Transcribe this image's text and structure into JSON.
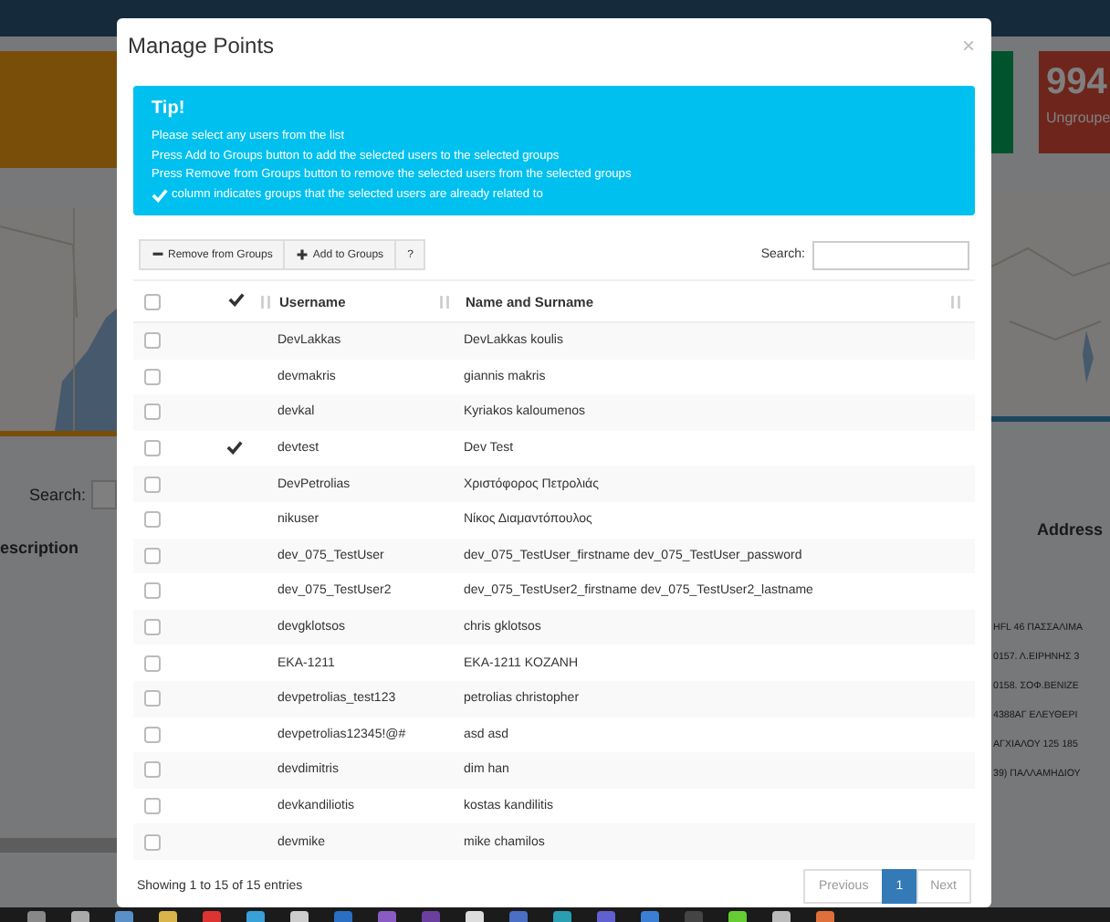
{
  "background": {
    "tile_number": "994",
    "tile_label": "Ungroupe",
    "search_label": "Search:",
    "left_column": "escription",
    "right_column": "Address",
    "addresses": [
      "HFL 46 ΠΑΣΣΑΛΙΜΑ",
      "0157. Λ.ΕΙΡΗΝΗΣ 3",
      "0158. ΣΟΦ.ΒΕΝΙΖΕ",
      "4388ΑΓ ΕΛΕΥΘΕΡΙ",
      "ΑΓΧΙΑΛΟΥ 125 185",
      "39) ΠΑΛΛΑΜΗΔΙΟΥ"
    ]
  },
  "modal": {
    "title": "Manage Points",
    "close": "×",
    "tip": {
      "title": "Tip!",
      "lines": [
        "Please select any users from the list",
        "Press Add to Groups button to add the selected users to the selected groups",
        "Press Remove from Groups button to remove the selected users from the selected groups",
        "column indicates groups that the selected users are already related to"
      ]
    },
    "toolbar": [
      {
        "label": "Remove from Groups",
        "kind": "remove"
      },
      {
        "label": "Add to Groups",
        "kind": "add"
      },
      {
        "label": "?",
        "kind": "help"
      }
    ],
    "search": {
      "label": "Search:"
    },
    "table": {
      "select_all": {
        "checked": false
      },
      "columns": [
        "Username",
        "Name and Surname"
      ],
      "rows": [
        {
          "checked": false,
          "related": false,
          "username": "DevLakkas",
          "name": "DevLakkas koulis"
        },
        {
          "checked": false,
          "related": false,
          "username": "devmakris",
          "name": "giannis makris"
        },
        {
          "checked": false,
          "related": false,
          "username": "devkal",
          "name": "Kyriakos kaloumenos"
        },
        {
          "checked": false,
          "related": true,
          "username": "devtest",
          "name": "Dev Test"
        },
        {
          "checked": false,
          "related": false,
          "username": "DevPetrolias",
          "name": "Χριστόφορος Πετρολιάς"
        },
        {
          "checked": false,
          "related": false,
          "username": "nikuser",
          "name": "Νίκος Διαμαντόπουλος"
        },
        {
          "checked": false,
          "related": false,
          "username": "dev_075_TestUser",
          "name": "dev_075_TestUser_firstname dev_075_TestUser_password"
        },
        {
          "checked": false,
          "related": false,
          "username": "dev_075_TestUser2",
          "name": "dev_075_TestUser2_firstname dev_075_TestUser2_lastname"
        },
        {
          "checked": false,
          "related": false,
          "username": "devgklotsos",
          "name": "chris gklotsos"
        },
        {
          "checked": false,
          "related": false,
          "username": "EKA-1211",
          "name": "EKA-1211 KOZANH"
        },
        {
          "checked": false,
          "related": false,
          "username": "devpetrolias_test123",
          "name": "petrolias christopher"
        },
        {
          "checked": false,
          "related": false,
          "username": "devpetrolias12345!@#",
          "name": "asd asd"
        },
        {
          "checked": false,
          "related": false,
          "username": "devdimitris",
          "name": "dim han"
        },
        {
          "checked": false,
          "related": false,
          "username": "devkandiliotis",
          "name": "kostas kandilitis"
        },
        {
          "checked": false,
          "related": false,
          "username": "devmike",
          "name": "mike chamilos"
        }
      ]
    },
    "info": "Showing 1 to 15 of 15 entries",
    "pagination": [
      {
        "label": "Previous",
        "selected": false
      },
      {
        "label": "1",
        "selected": true
      },
      {
        "label": "Next",
        "selected": false
      }
    ]
  }
}
